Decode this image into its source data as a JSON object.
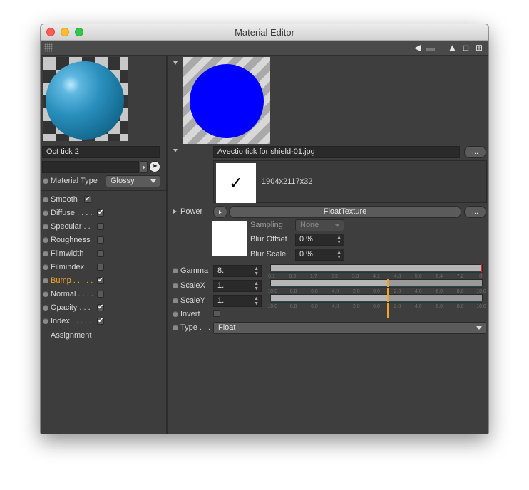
{
  "window": {
    "title": "Material Editor"
  },
  "toolbar": {
    "icons": [
      "grip-icon",
      "back-arrow-icon",
      "up-arrow-icon",
      "lock-icon",
      "new-window-icon"
    ]
  },
  "left": {
    "material_name": "Oct tick 2",
    "search_value": "",
    "material_type_label": "Material Type",
    "material_type_value": "Glossy",
    "channels": [
      {
        "label": "Smooth",
        "checked": true
      },
      {
        "label": "Diffuse . . . .",
        "checked": true
      },
      {
        "label": "Specular . .",
        "checked": false
      },
      {
        "label": "Roughness",
        "checked": false
      },
      {
        "label": "Filmwidth",
        "checked": false
      },
      {
        "label": "Filmindex",
        "checked": false
      },
      {
        "label": "Bump . . . . .",
        "checked": true,
        "active": true
      },
      {
        "label": "Normal . . . .",
        "checked": false
      },
      {
        "label": "Opacity . . .",
        "checked": true
      },
      {
        "label": "Index . . . . .",
        "checked": true
      }
    ],
    "assignment_label": "Assignment"
  },
  "right": {
    "file_name": "Avectio tick for shield-01.jpg",
    "browse_label": "...",
    "texture_check": "✓",
    "texture_dims": "1904x2117x32",
    "power_label": "Power",
    "texture_type": "FloatTexture",
    "texture_more": "...",
    "sampling_label": "Sampling",
    "sampling_value": "None",
    "blur_offset_label": "Blur Offset",
    "blur_offset_value": "0 %",
    "blur_scale_label": "Blur Scale",
    "blur_scale_value": "0 %",
    "gamma_label": "Gamma",
    "gamma_value": "8.",
    "gamma_ticks": [
      "0.1",
      "0.9",
      "1.7",
      "2.5",
      "3.3",
      "4.1",
      "4.8",
      "5.6",
      "6.4",
      "7.2",
      "8."
    ],
    "gamma_level": 1.0,
    "scalex_label": "ScaleX",
    "scalex_value": "1.",
    "scalex_ticks": [
      "-10.0",
      "-8.0",
      "-6.0",
      "-4.0",
      "-2.0",
      "0.0",
      "2.0",
      "4.0",
      "6.0",
      "8.0",
      "10.0"
    ],
    "scalex_level": 0.55,
    "scaley_label": "ScaleY",
    "scaley_value": "1.",
    "scaley_ticks": [
      "-10.0",
      "-8.0",
      "-6.0",
      "-4.0",
      "-2.0",
      "0.0",
      "2.0",
      "4.0",
      "6.0",
      "8.0",
      "10.0"
    ],
    "scaley_level": 0.55,
    "invert_label": "Invert",
    "invert_checked": false,
    "type_label": "Type . . .",
    "type_value": "Float"
  },
  "colors": {
    "accent": "#f0a52a",
    "texture_circle": "#0000fe"
  }
}
